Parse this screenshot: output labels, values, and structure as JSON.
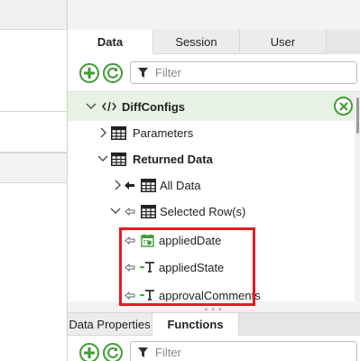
{
  "tabs": [
    {
      "label": "Data",
      "active": true
    },
    {
      "label": "Session",
      "active": false
    },
    {
      "label": "User",
      "active": false
    }
  ],
  "toolbar": {
    "add_icon": "plus-circle-icon",
    "refresh_icon": "refresh-circle-icon",
    "filter_placeholder": "Filter"
  },
  "tree": {
    "root": {
      "label": "DiffConfigs",
      "icon": "code-tag-icon",
      "close_icon": "close-circle-icon"
    },
    "items": [
      {
        "label": "Parameters",
        "icon": "table-icon",
        "expanded": false
      },
      {
        "label": "Returned Data",
        "icon": "table-icon",
        "expanded": true
      },
      {
        "label": "All Data",
        "icon": "table-icon",
        "expanded": false
      },
      {
        "label": "Selected Row(s)",
        "icon": "table-icon",
        "expanded": true
      },
      {
        "label": "appliedDate",
        "icon": "calendar-icon"
      },
      {
        "label": "appliedState",
        "icon": "text-field-icon"
      },
      {
        "label": "approvalComments",
        "icon": "text-field-icon"
      }
    ]
  },
  "bottom_tabs": [
    {
      "label": "Data Properties",
      "active": false
    },
    {
      "label": "Functions",
      "active": true
    }
  ],
  "bottom_toolbar": {
    "filter_placeholder": "Filter"
  },
  "colors": {
    "accent_green": "#3f9c35",
    "highlight_red": "#e31b23",
    "root_bg": "#e8f2e4"
  }
}
